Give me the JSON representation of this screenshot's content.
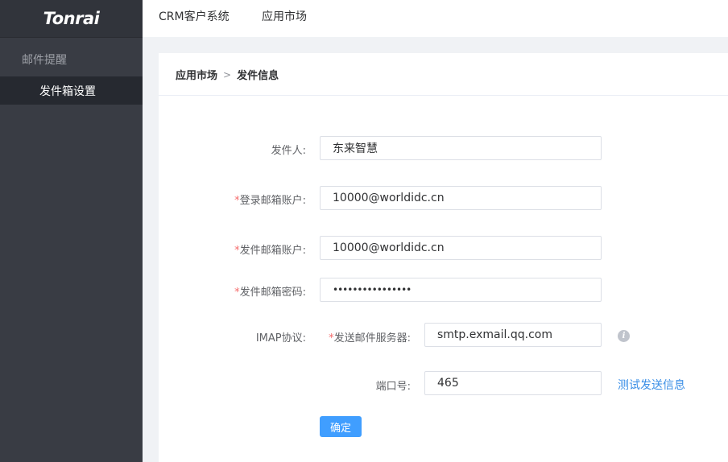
{
  "brand": {
    "logo_text": "Tonrai"
  },
  "sidebar": {
    "group_label": "邮件提醒",
    "items": [
      {
        "label": "发件箱设置"
      }
    ]
  },
  "topnav": {
    "items": [
      {
        "label": "CRM客户系统"
      },
      {
        "label": "应用市场"
      }
    ]
  },
  "breadcrumb": {
    "parent": "应用市场",
    "separator": ">",
    "current": "发件信息"
  },
  "form": {
    "sender": {
      "label": "发件人:",
      "value": "东来智慧"
    },
    "login_account": {
      "required_mark": "*",
      "label": "登录邮箱账户:",
      "value": "10000@worldidc.cn"
    },
    "send_account": {
      "required_mark": "*",
      "label": "发件邮箱账户:",
      "value": "10000@worldidc.cn"
    },
    "send_password": {
      "required_mark": "*",
      "label": "发件邮箱密码:",
      "value": "••••••••••••••••"
    },
    "imap": {
      "label": "IMAP协议:"
    },
    "smtp_server": {
      "required_mark": "*",
      "label": "发送邮件服务器:",
      "value": "smtp.exmail.qq.com",
      "info_icon": "i"
    },
    "port": {
      "label": "端口号:",
      "value": "465"
    },
    "test_link": "测试发送信息",
    "submit_label": "确定"
  },
  "colors": {
    "sidebar_bg": "#393c44",
    "sidebar_active_bg": "#262930",
    "primary": "#409eff",
    "required": "#f56c6c",
    "link": "#3a8ee6"
  }
}
